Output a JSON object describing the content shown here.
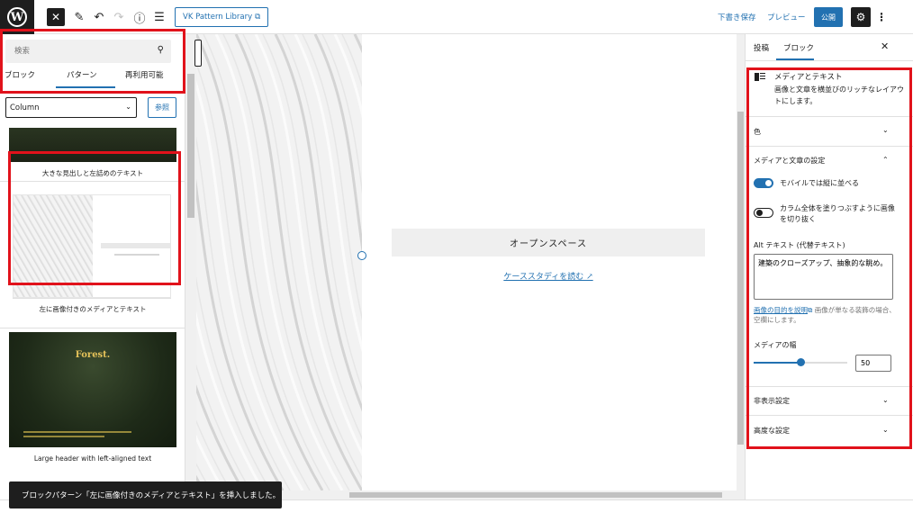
{
  "topbar": {
    "logo_letter": "W",
    "close_icon": "close-icon",
    "vk_pattern_label": "VK Pattern Library",
    "save_draft_label": "下書き保存",
    "preview_label": "プレビュー",
    "publish_label": "公開"
  },
  "inserter": {
    "search_placeholder": "検索",
    "tabs": [
      {
        "label": "ブロック"
      },
      {
        "label": "パターン"
      },
      {
        "label": "再利用可能"
      }
    ],
    "category_select": "Column",
    "browse_label": "参照",
    "patterns": [
      {
        "caption": "大きな見出しと左詰めのテキスト"
      },
      {
        "caption": "左に画像付きのメディアとテキスト"
      },
      {
        "caption": "Large header with left-aligned text",
        "title": "Forest."
      }
    ]
  },
  "canvas": {
    "heading": "オープンスペース",
    "link": "ケーススタディを読む ↗"
  },
  "sidebar": {
    "tabs": [
      {
        "label": "投稿"
      },
      {
        "label": "ブロック"
      }
    ],
    "block": {
      "title": "メディアとテキスト",
      "description": "画像と文章を横並びのリッチなレイアウトにします。"
    },
    "panels": {
      "color": "色",
      "media_text_settings": "メディアと文章の設定",
      "hidden_settings": "非表示設定",
      "advanced": "高度な設定"
    },
    "toggles": [
      {
        "label": "モバイルでは縦に並べる",
        "on": true
      },
      {
        "label": "カラム全体を塗りつぶすように画像を切り抜く",
        "on": false
      }
    ],
    "alt": {
      "label": "Alt テキスト (代替テキスト)",
      "value": "建築のクローズアップ、抽象的な眺め。",
      "help_link": "画像の目的を説明",
      "help_text": "画像が単なる装飾の場合、空欄にします。"
    },
    "media_width": {
      "label": "メディアの幅",
      "value": "50",
      "percent": 50
    }
  },
  "snackbar": {
    "message": "ブロックパターン「左に画像付きのメディアとテキスト」を挿入しました。"
  },
  "colors": {
    "accent": "#2271b1",
    "highlight": "#e1121b",
    "dark": "#1e1e1e"
  }
}
